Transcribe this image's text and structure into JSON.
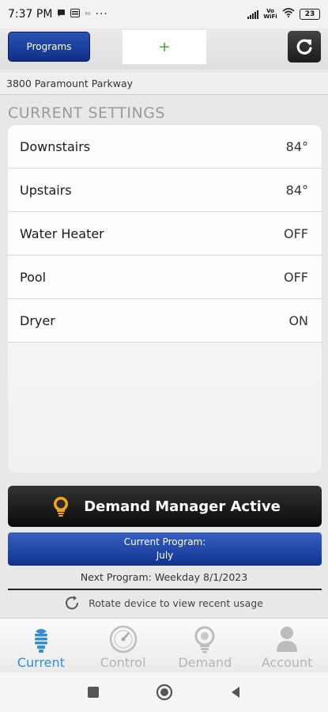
{
  "status_bar": {
    "time": "7:37 PM",
    "network_label": "Vo WiFi",
    "battery": "23"
  },
  "toolbar": {
    "programs_label": "Programs",
    "add_label": "+"
  },
  "address": "3800 Paramount Parkway",
  "current_settings": {
    "title": "CURRENT SETTINGS",
    "rows": [
      {
        "label": "Downstairs",
        "value": "84°"
      },
      {
        "label": "Upstairs",
        "value": "84°"
      },
      {
        "label": "Water Heater",
        "value": "OFF"
      },
      {
        "label": "Pool",
        "value": "OFF"
      },
      {
        "label": "Dryer",
        "value": "ON"
      }
    ]
  },
  "demand_banner": {
    "label": "Demand Manager Active",
    "icon": "lightbulb-icon"
  },
  "program": {
    "current_label": "Current Program:",
    "current_value": "July",
    "next_text": "Next Program: Weekday 8/1/2023"
  },
  "rotate_hint": "Rotate device to view recent usage",
  "tabs": [
    {
      "label": "Current",
      "icon": "bulb-icon",
      "active": true
    },
    {
      "label": "Control",
      "icon": "gauge-icon",
      "active": false
    },
    {
      "label": "Demand",
      "icon": "demand-icon",
      "active": false
    },
    {
      "label": "Account",
      "icon": "person-icon",
      "active": false
    }
  ],
  "colors": {
    "accent_blue": "#2f8ed6",
    "button_blue": "#1b3f9e",
    "banner_dark": "#111111",
    "add_green": "#3fa33a"
  }
}
